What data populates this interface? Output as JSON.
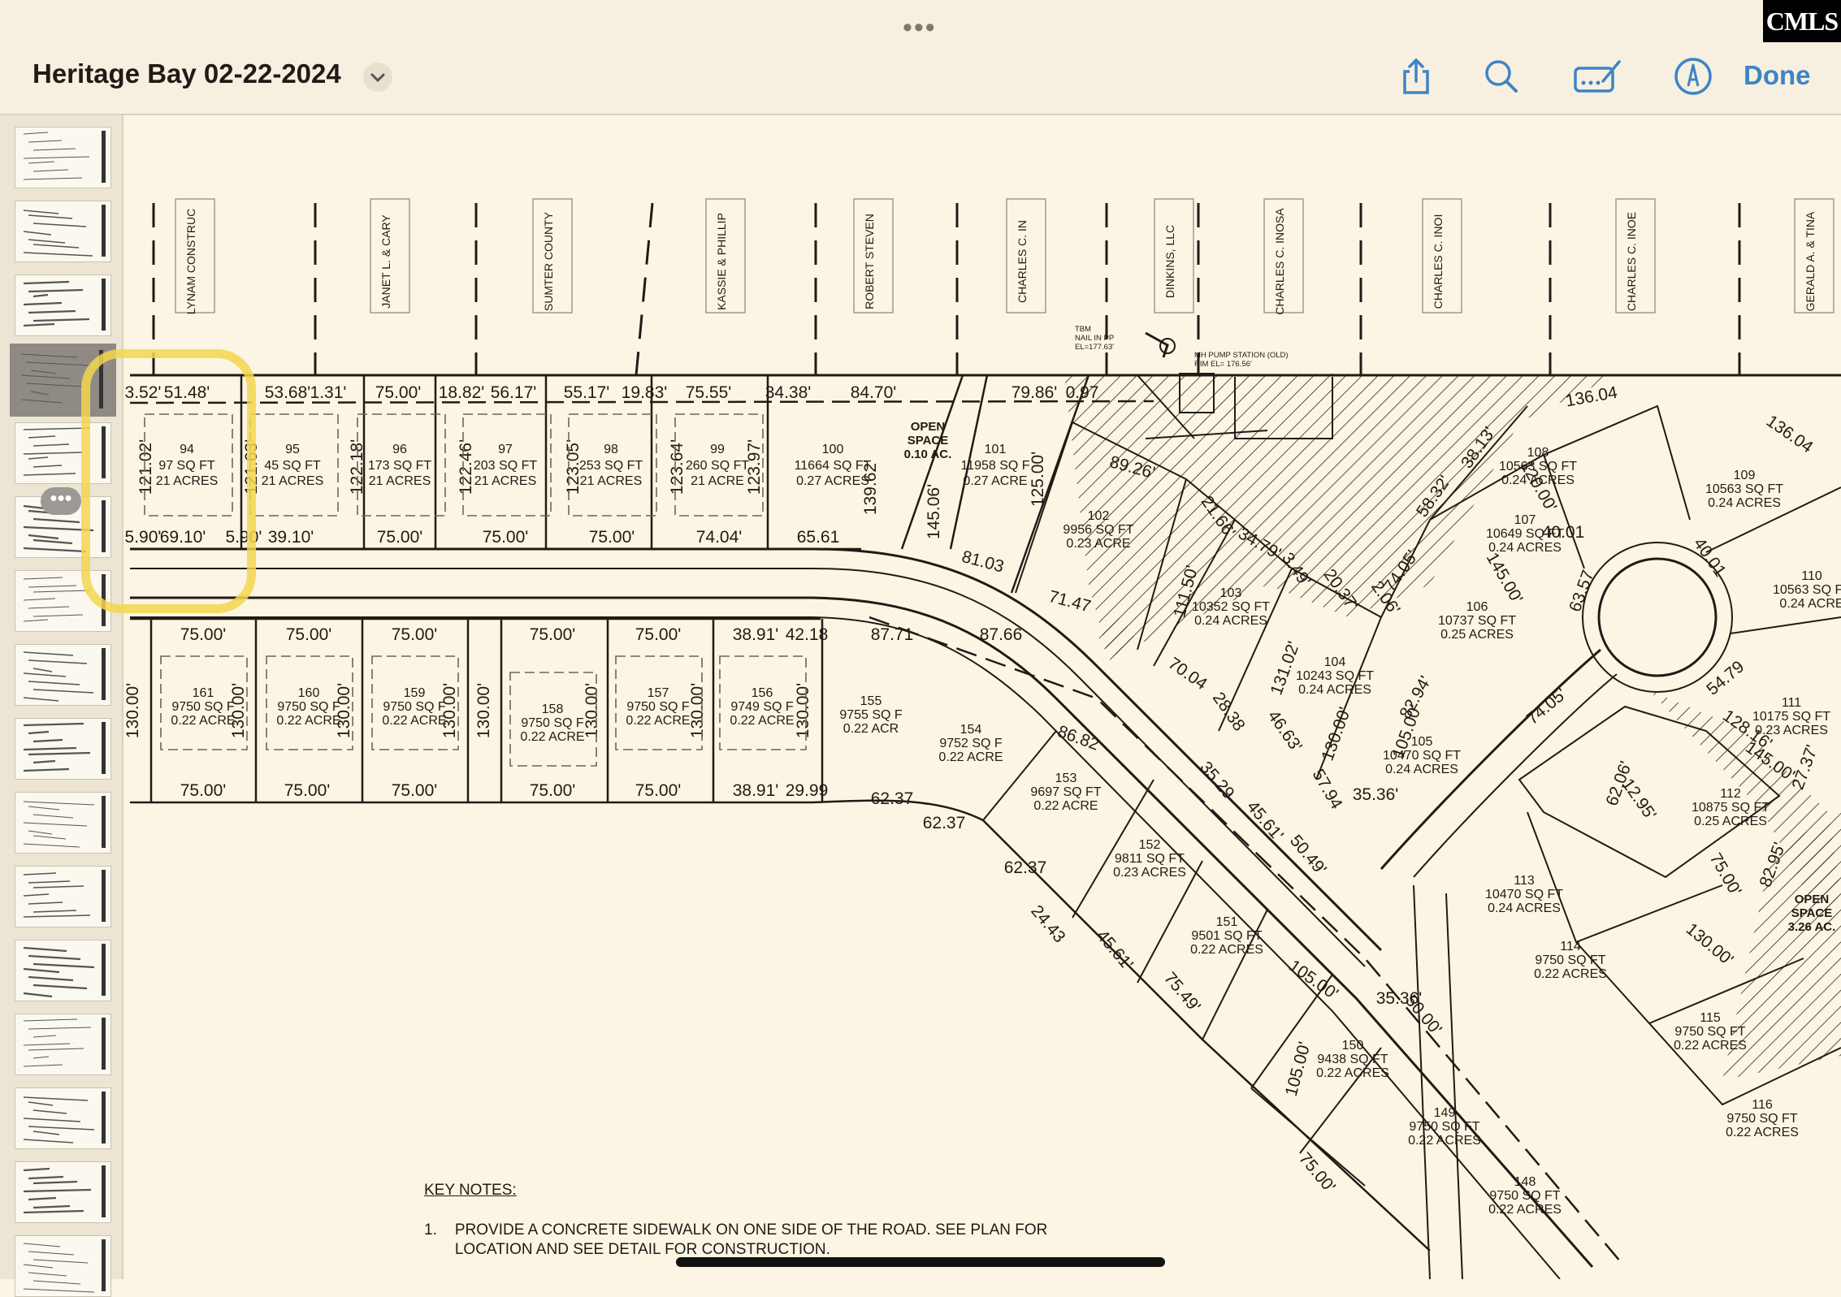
{
  "app": {
    "title": "Heritage Bay 02-22-2024",
    "done_label": "Done",
    "brand_logo": "CMLS",
    "grabber": "•••",
    "more_dots": "•••"
  },
  "toolbar_icons": [
    "share-icon",
    "search-icon",
    "markup-icon",
    "pen-icon"
  ],
  "thumbnails": {
    "count": 16,
    "selected_index": 3
  },
  "plat": {
    "owner_labels": [
      "LYNAM CONSTRUC",
      "JANET L. & CARY",
      "SUMTER COUNTY",
      "KASSIE & PHILLIP",
      "ROBERT STEVEN",
      "CHARLES C. IN",
      "DINKINS, LLC",
      "CHARLES C. INOSA",
      "CHARLES C. INOI",
      "CHARLES C. INOE",
      "GERALD A. & TINA"
    ],
    "frontage_top": [
      "3.52'",
      "51.48'",
      "53.68'",
      "1.31'",
      "75.00'",
      "18.82'",
      "56.17'",
      "55.17'",
      "19.83'",
      "75.55'",
      "34.38'",
      "84.70'",
      "79.86'",
      "0.97"
    ],
    "frontage_bottom": [
      "5.90'",
      "69.10'",
      "5.90'",
      "39.10'",
      "75.00'",
      "75.00'",
      "75.00'",
      "74.04'",
      "65.61"
    ],
    "depths": [
      "121.02'",
      "121.63'",
      "122.18'",
      "122.46'",
      "123.05'",
      "123.64'",
      "123.97'",
      "139.62'",
      "145.06'",
      "125.00'"
    ],
    "top_lots": [
      {
        "num": "94",
        "sqft": "97 SQ FT",
        "acres": "21 ACRES"
      },
      {
        "num": "95",
        "sqft": "45 SQ FT",
        "acres": "21 ACRES"
      },
      {
        "num": "96",
        "sqft": "173 SQ FT",
        "acres": "21 ACRES"
      },
      {
        "num": "97",
        "sqft": "203 SQ FT",
        "acres": "21 ACRES"
      },
      {
        "num": "98",
        "sqft": "253 SQ FT",
        "acres": "21 ACRES"
      },
      {
        "num": "99",
        "sqft": "260 SQ FT",
        "acres": "21 ACRE"
      },
      {
        "num": "100",
        "sqft": "11664 SQ FT",
        "acres": "0.27 ACRES"
      },
      {
        "num": "101",
        "sqft": "11958 SQ F",
        "acres": "0.27 ACRE"
      }
    ],
    "open_space_top": [
      "OPEN",
      "SPACE",
      "0.10 AC."
    ],
    "bottom_frontage_top": [
      "75.00'",
      "75.00'",
      "75.00'",
      "75.00'",
      "75.00'",
      "38.91'",
      "42.18",
      "87.71",
      "87.66"
    ],
    "bottom_frontage_bottom": [
      "75.00'",
      "75.00'",
      "75.00'",
      "75.00'",
      "75.00'",
      "38.91'",
      "29.99",
      "62.37",
      "62.37",
      "62.37"
    ],
    "bottom_depth": "130.00'",
    "bottom_lots": [
      {
        "num": "161",
        "sqft": "9750 SQ F",
        "acres": "0.22 ACRE"
      },
      {
        "num": "160",
        "sqft": "9750 SQ F",
        "acres": "0.22 ACRE"
      },
      {
        "num": "159",
        "sqft": "9750 SQ F",
        "acres": "0.22 ACRE"
      },
      {
        "num": "158",
        "sqft": "9750 SQ F",
        "acres": "0.22 ACRE"
      },
      {
        "num": "157",
        "sqft": "9750 SQ F",
        "acres": "0.22 ACRE"
      },
      {
        "num": "156",
        "sqft": "9749 SQ F",
        "acres": "0.22 ACRE"
      },
      {
        "num": "155",
        "sqft": "9755 SQ F",
        "acres": "0.22 ACR"
      },
      {
        "num": "154",
        "sqft": "9752 SQ F",
        "acres": "0.22 ACRE"
      },
      {
        "num": "153",
        "sqft": "9697 SQ FT",
        "acres": "0.22 ACRE"
      },
      {
        "num": "152",
        "sqft": "9811 SQ FT",
        "acres": "0.23 ACRES"
      },
      {
        "num": "151",
        "sqft": "9501 SQ FT",
        "acres": "0.22 ACRES"
      }
    ],
    "right_lots": [
      {
        "num": "102",
        "sqft": "9956 SQ FT",
        "acres": "0.23 ACRE"
      },
      {
        "num": "103",
        "sqft": "10352 SQ FT",
        "acres": "0.24 ACRES"
      },
      {
        "num": "104",
        "sqft": "10243 SQ FT",
        "acres": "0.24 ACRES"
      },
      {
        "num": "105",
        "sqft": "10470 SQ FT",
        "acres": "0.24 ACRES"
      },
      {
        "num": "106",
        "sqft": "10737 SQ FT",
        "acres": "0.25 ACRES"
      },
      {
        "num": "107",
        "sqft": "10649 SQ FT",
        "acres": "0.24 ACRES"
      },
      {
        "num": "108",
        "sqft": "10563 SQ FT",
        "acres": "0.24 ACRES"
      },
      {
        "num": "109",
        "sqft": "10563 SQ FT",
        "acres": "0.24 ACRES"
      },
      {
        "num": "110",
        "sqft": "10563 SQ FT",
        "acres": "0.24 ACRE"
      },
      {
        "num": "111",
        "sqft": "10175 SQ FT",
        "acres": "0.23 ACRES"
      },
      {
        "num": "112",
        "sqft": "10875 SQ FT",
        "acres": "0.25 ACRES"
      },
      {
        "num": "113",
        "sqft": "10470 SQ FT",
        "acres": "0.24 ACRES"
      },
      {
        "num": "114",
        "sqft": "9750 SQ FT",
        "acres": "0.22 ACRES"
      },
      {
        "num": "115",
        "sqft": "9750 SQ FT",
        "acres": "0.22 ACRES"
      },
      {
        "num": "116",
        "sqft": "9750 SQ FT",
        "acres": "0.22 ACRES"
      },
      {
        "num": "148",
        "sqft": "9750 SQ FT",
        "acres": "0.22 ACRES"
      },
      {
        "num": "149",
        "sqft": "9750 SQ FT",
        "acres": "0.22 ACRES"
      },
      {
        "num": "150",
        "sqft": "9438 SQ FT",
        "acres": "0.22 ACRES"
      }
    ],
    "misc_dims": [
      "89.26'",
      "81.03",
      "71.47",
      "21.66'",
      "34.79'",
      "3.49'",
      "20.37'",
      "2.06'",
      "74.05'",
      "58.32'",
      "38.13'",
      "120.00'",
      "136.04",
      "136.04",
      "40.01",
      "40.01",
      "63.57",
      "145.00'",
      "111.50'",
      "131.02'",
      "130.00'",
      "105.00'",
      "82.94'",
      "70.04",
      "28.38",
      "46.63'",
      "57.94",
      "35.36'",
      "74.05'",
      "54.79",
      "128.16'",
      "145.00'",
      "27.37'",
      "86.82",
      "35.29",
      "45.61'",
      "50.49'",
      "24.43",
      "45.61'",
      "75.49'",
      "105.00'",
      "35.36'",
      "50.00'",
      "105.00'",
      "75.00'",
      "62.06'",
      "75.00'",
      "82.95'",
      "12.95'",
      "130.00'"
    ],
    "open_space_right": [
      "OPEN",
      "SPACE",
      "3.26 AC."
    ],
    "tbm_note": [
      "TBM",
      "NAIL IN PP",
      "EL=177.63'"
    ],
    "pump_note": [
      "MH PUMP STATION (OLD)",
      "RIM EL= 176.56'"
    ]
  },
  "key_notes": {
    "title": "KEY NOTES:",
    "items": [
      {
        "num": "1.",
        "text": "PROVIDE A CONCRETE SIDEWALK ON ONE SIDE OF THE ROAD.  SEE PLAN FOR LOCATION AND SEE DETAIL FOR CONSTRUCTION."
      }
    ]
  },
  "colors": {
    "highlight": "#f3d64f",
    "accent": "#3d84c6",
    "paper": "#fdf5e3"
  }
}
